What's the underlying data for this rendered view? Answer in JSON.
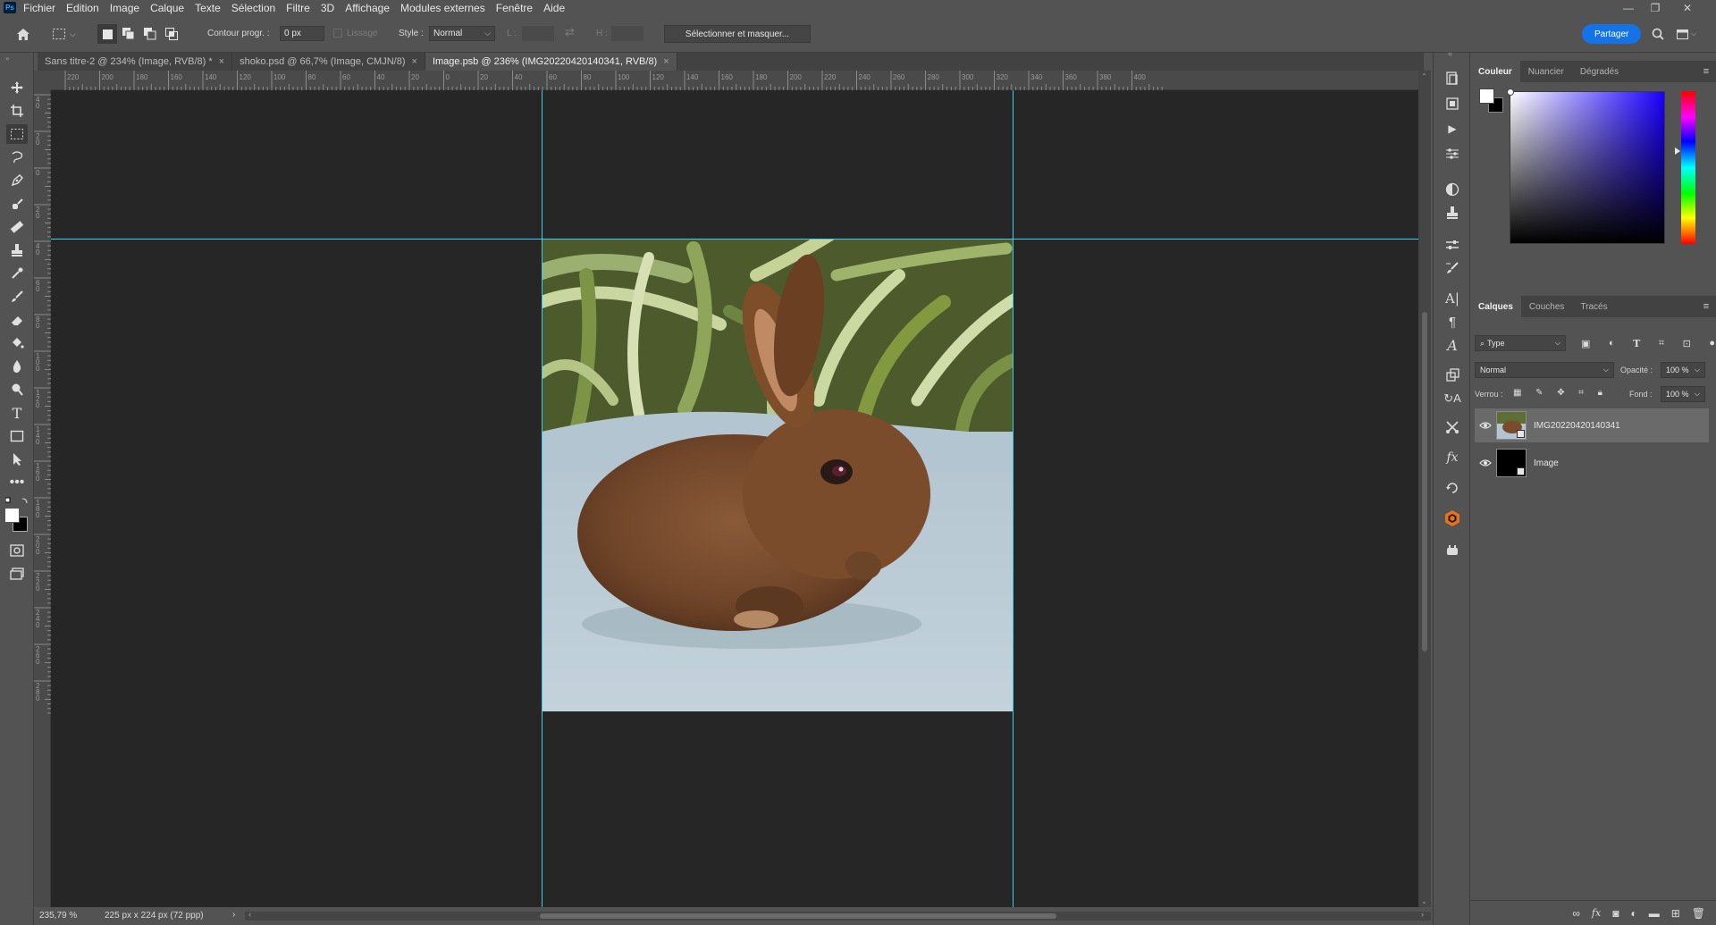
{
  "menu": [
    "Fichier",
    "Edition",
    "Image",
    "Calque",
    "Texte",
    "Sélection",
    "Filtre",
    "3D",
    "Affichage",
    "Modules externes",
    "Fenêtre",
    "Aide"
  ],
  "app": {
    "logo": "Ps"
  },
  "window_controls": {
    "minimize": "—",
    "restore": "❐",
    "close": "✕"
  },
  "options": {
    "contour_label": "Contour progr. :",
    "contour_value": "0 px",
    "lissage_label": "Lissage",
    "style_label": "Style :",
    "style_value": "Normal",
    "width_label": "L :",
    "height_label": "H :",
    "select_mask_button": "Sélectionner et masquer...",
    "share_button": "Partager"
  },
  "tabs": [
    {
      "title": "Sans titre-2 @ 234% (Image, RVB/8) *",
      "active": false
    },
    {
      "title": "shoko.psd @ 66,7% (Image, CMJN/8)",
      "active": false
    },
    {
      "title": "Image.psb @ 236% (IMG20220420140341, RVB/8)",
      "active": true
    }
  ],
  "ruler": {
    "top_ticks": [
      "220",
      "200",
      "180",
      "160",
      "140",
      "120",
      "100",
      "80",
      "60",
      "40",
      "20",
      "0",
      "20",
      "40",
      "60",
      "80",
      "100",
      "120",
      "140",
      "160",
      "180",
      "200",
      "220",
      "240",
      "260",
      "280",
      "300",
      "320",
      "340",
      "360",
      "380",
      "400"
    ],
    "left_ticks": [
      "4 0",
      "2 0",
      "0",
      "2 0",
      "4 0",
      "6 0",
      "8 0",
      "1 0 0",
      "1 2 0",
      "1 4 0",
      "1 6 0",
      "1 8 0",
      "2 0 0",
      "2 2 0",
      "2 4 0",
      "2 6 0",
      "2 8 0"
    ]
  },
  "status": {
    "zoom": "235,79 %",
    "doc_info": "225 px x 224 px (72 ppp)"
  },
  "tools": [
    "move-tool-icon",
    "crop-tool-icon",
    "marquee-tool-icon",
    "lasso-tool-icon",
    "pen-tool-icon",
    "healing-brush-icon",
    "ruler-tool-icon",
    "stamp-tool-icon",
    "eyedropper-icon",
    "brush-tool-icon",
    "eraser-tool-icon",
    "paint-bucket-icon",
    "blur-tool-icon",
    "dodge-tool-icon",
    "type-tool-icon",
    "rectangle-tool-icon",
    "path-select-icon",
    "more-tools-icon"
  ],
  "color_panel": {
    "tabs": [
      "Couleur",
      "Nuancier",
      "Dégradés"
    ],
    "foreground": "#ffffff",
    "background": "#000000",
    "hue_color": "#1a00ff"
  },
  "layers_panel": {
    "tabs": [
      "Calques",
      "Couches",
      "Tracés"
    ],
    "filter_label": "Type",
    "blend_mode": "Normal",
    "opacity_label": "Opacité :",
    "opacity_value": "100 %",
    "lock_label": "Verrou :",
    "fill_label": "Fond :",
    "fill_value": "100 %",
    "layers": [
      {
        "name": "IMG20220420140341",
        "selected": true
      },
      {
        "name": "Image",
        "selected": false
      }
    ]
  },
  "colors": {
    "guide": "#38d0e8",
    "accent": "#1473e6"
  }
}
